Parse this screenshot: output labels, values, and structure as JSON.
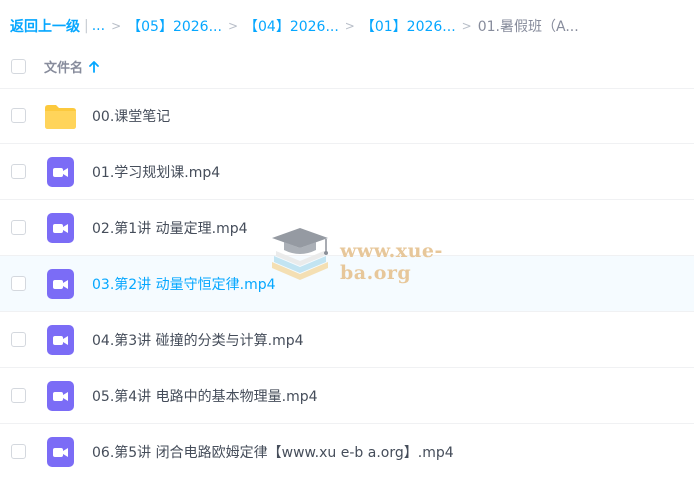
{
  "breadcrumb": {
    "back_label": "返回上一级",
    "separator": "|",
    "ellipsis": "...",
    "crumbs": [
      "【05】2026...",
      "【04】2026...",
      "【01】2026..."
    ],
    "current": "01.暑假班（A..."
  },
  "header": {
    "column_name": "文件名",
    "sort_icon": "arrow-up-icon"
  },
  "files": [
    {
      "name": "00.课堂笔记",
      "type": "folder"
    },
    {
      "name": "01.学习规划课.mp4",
      "type": "video"
    },
    {
      "name": "02.第1讲 动量定理.mp4",
      "type": "video"
    },
    {
      "name": "03.第2讲 动量守恒定律.mp4",
      "type": "video",
      "active": true
    },
    {
      "name": "04.第3讲 碰撞的分类与计算.mp4",
      "type": "video"
    },
    {
      "name": "05.第4讲 电路中的基本物理量.mp4",
      "type": "video"
    },
    {
      "name": "06.第5讲 闭合电路欧姆定律【www.xu e-b a.org】.mp4",
      "type": "video"
    }
  ],
  "watermark": {
    "text": "www.xue-ba.org"
  },
  "colors": {
    "accent": "#06a7ff",
    "folder": "#fcc93d",
    "video": "#7b6cf6"
  }
}
